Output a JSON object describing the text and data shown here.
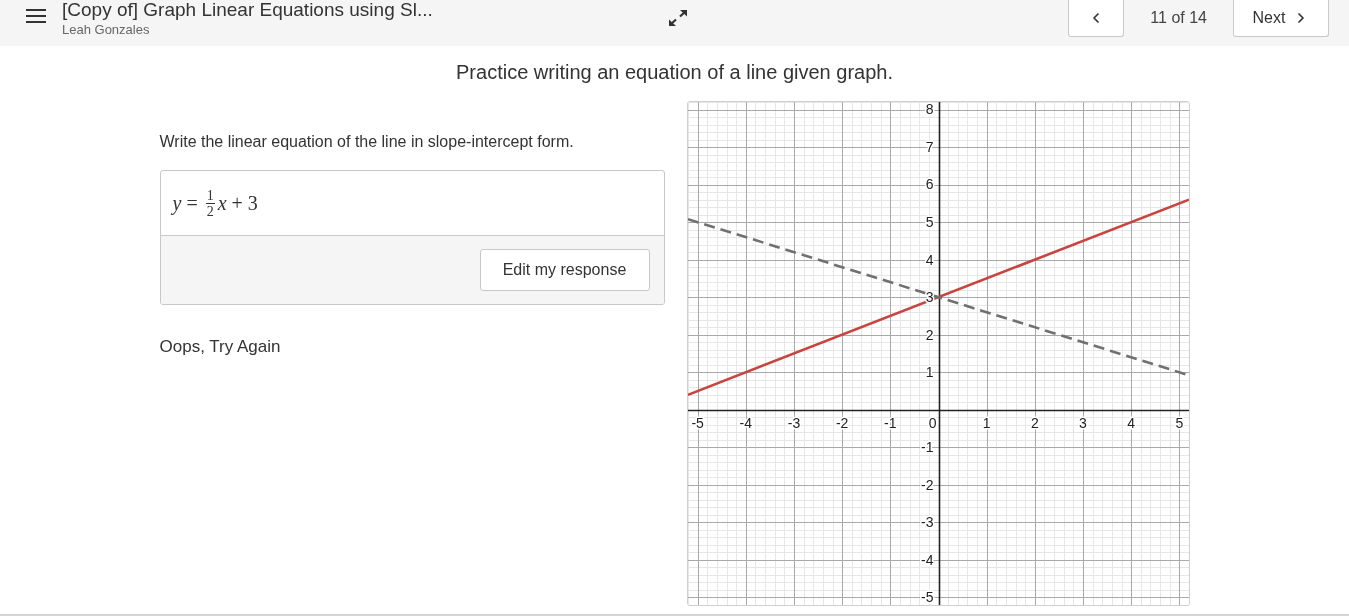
{
  "header": {
    "title": "[Copy of] Graph Linear Equations using Sl...",
    "author": "Leah Gonzales",
    "counter": "11 of 14",
    "next_label": "Next"
  },
  "page_title": "Practice writing an equation of a line given graph.",
  "question": {
    "prompt": "Write the linear equation of the line in slope-intercept form.",
    "response": [
      {
        "kind": "variable",
        "text": "y"
      },
      {
        "kind": "symbol",
        "text": "="
      },
      {
        "kind": "fraction",
        "numerator": "1",
        "denominator": "2"
      },
      {
        "kind": "variable",
        "text": "x"
      },
      {
        "kind": "symbol",
        "text": "+"
      },
      {
        "kind": "number",
        "text": "3"
      }
    ],
    "edit_button": "Edit my response",
    "feedback": "Oops, Try Again"
  },
  "graph": {
    "chart_data": {
      "type": "line",
      "grid": true,
      "x": [
        -5.2,
        5.2
      ],
      "series": [
        {
          "color": "#c8453f",
          "line_style": "solid",
          "values": [
            0.4,
            5.6
          ]
        },
        {
          "color": "#707070",
          "line_style": "dashed",
          "values": [
            5.08,
            0.92
          ]
        }
      ],
      "xlim": [
        -5.2,
        5.2
      ],
      "ylim": [
        -5.2,
        8.2
      ],
      "xticks": [
        -5,
        -4,
        -3,
        -2,
        -1,
        0,
        1,
        2,
        3,
        4,
        5
      ],
      "yticks": [
        -5,
        -4,
        -3,
        -2,
        -1,
        1,
        2,
        3,
        4,
        5,
        6,
        7,
        8
      ]
    }
  }
}
